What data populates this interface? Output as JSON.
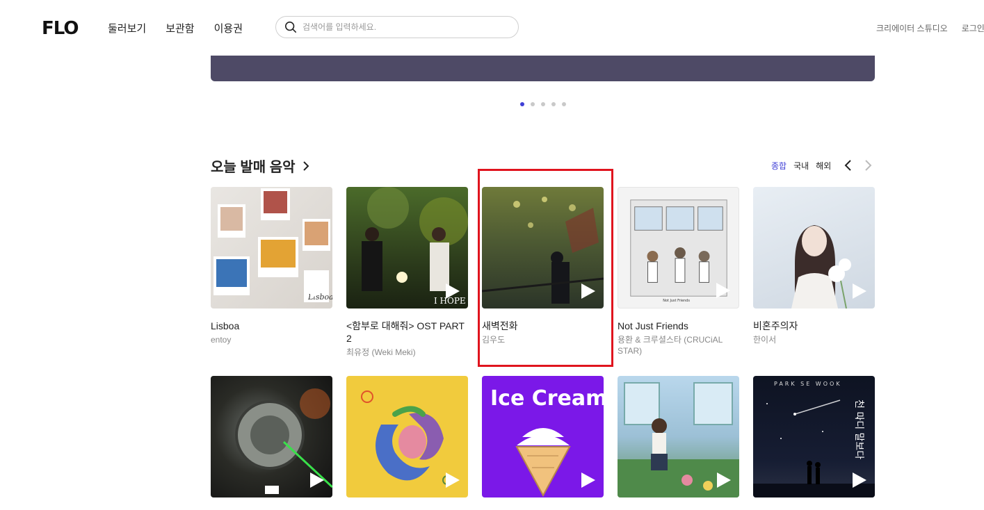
{
  "header": {
    "logo": "FLO",
    "nav": [
      "둘러보기",
      "보관함",
      "이용권"
    ],
    "search_placeholder": "검색어를 입력하세요.",
    "right_links": [
      "크리에이터 스튜디오",
      "로그인"
    ]
  },
  "carousel": {
    "dot_count": 5,
    "active_index": 0
  },
  "section": {
    "title": "오늘 발매 음악",
    "filters": [
      "종합",
      "국내",
      "해외"
    ],
    "active_filter": "종합"
  },
  "albums": [
    {
      "title": "Lisboa",
      "artist": "entoy"
    },
    {
      "title": "<함부로 대해줘> OST PART 2",
      "artist": "최유정 (Weki Meki)"
    },
    {
      "title": "새벽전화",
      "artist": "김우도"
    },
    {
      "title": "Not Just Friends",
      "artist": "용환 & 크루셜스타 (CRUCiAL STAR)"
    },
    {
      "title": "비혼주의자",
      "artist": "한이서"
    }
  ],
  "cover_text": {
    "lisboa": "Lisboa",
    "ost": "I HOPE",
    "ice_cream": "Ice Cream",
    "not_just_friends": "Not Just Friends",
    "park_se_wook": "PARK SE WOOK",
    "park_se_wook_kr": "천 마디 말보다"
  },
  "colors": {
    "accent": "#3f3fd6",
    "banner": "#4e4a66",
    "highlight": "#e0141e"
  }
}
